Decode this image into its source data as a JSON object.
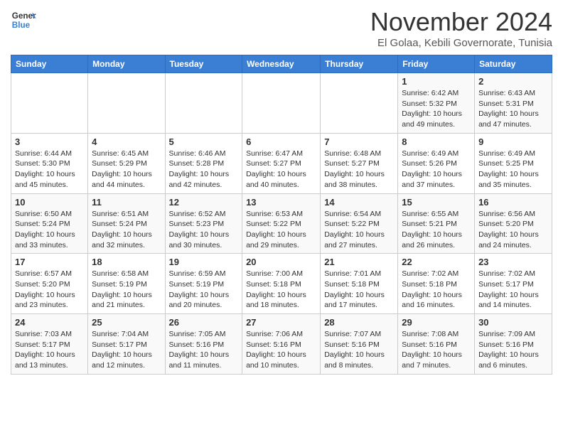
{
  "logo": {
    "line1": "General",
    "line2": "Blue"
  },
  "title": "November 2024",
  "subtitle": "El Golaa, Kebili Governorate, Tunisia",
  "weekdays": [
    "Sunday",
    "Monday",
    "Tuesday",
    "Wednesday",
    "Thursday",
    "Friday",
    "Saturday"
  ],
  "weeks": [
    [
      {
        "day": "",
        "info": ""
      },
      {
        "day": "",
        "info": ""
      },
      {
        "day": "",
        "info": ""
      },
      {
        "day": "",
        "info": ""
      },
      {
        "day": "",
        "info": ""
      },
      {
        "day": "1",
        "info": "Sunrise: 6:42 AM\nSunset: 5:32 PM\nDaylight: 10 hours\nand 49 minutes."
      },
      {
        "day": "2",
        "info": "Sunrise: 6:43 AM\nSunset: 5:31 PM\nDaylight: 10 hours\nand 47 minutes."
      }
    ],
    [
      {
        "day": "3",
        "info": "Sunrise: 6:44 AM\nSunset: 5:30 PM\nDaylight: 10 hours\nand 45 minutes."
      },
      {
        "day": "4",
        "info": "Sunrise: 6:45 AM\nSunset: 5:29 PM\nDaylight: 10 hours\nand 44 minutes."
      },
      {
        "day": "5",
        "info": "Sunrise: 6:46 AM\nSunset: 5:28 PM\nDaylight: 10 hours\nand 42 minutes."
      },
      {
        "day": "6",
        "info": "Sunrise: 6:47 AM\nSunset: 5:27 PM\nDaylight: 10 hours\nand 40 minutes."
      },
      {
        "day": "7",
        "info": "Sunrise: 6:48 AM\nSunset: 5:27 PM\nDaylight: 10 hours\nand 38 minutes."
      },
      {
        "day": "8",
        "info": "Sunrise: 6:49 AM\nSunset: 5:26 PM\nDaylight: 10 hours\nand 37 minutes."
      },
      {
        "day": "9",
        "info": "Sunrise: 6:49 AM\nSunset: 5:25 PM\nDaylight: 10 hours\nand 35 minutes."
      }
    ],
    [
      {
        "day": "10",
        "info": "Sunrise: 6:50 AM\nSunset: 5:24 PM\nDaylight: 10 hours\nand 33 minutes."
      },
      {
        "day": "11",
        "info": "Sunrise: 6:51 AM\nSunset: 5:24 PM\nDaylight: 10 hours\nand 32 minutes."
      },
      {
        "day": "12",
        "info": "Sunrise: 6:52 AM\nSunset: 5:23 PM\nDaylight: 10 hours\nand 30 minutes."
      },
      {
        "day": "13",
        "info": "Sunrise: 6:53 AM\nSunset: 5:22 PM\nDaylight: 10 hours\nand 29 minutes."
      },
      {
        "day": "14",
        "info": "Sunrise: 6:54 AM\nSunset: 5:22 PM\nDaylight: 10 hours\nand 27 minutes."
      },
      {
        "day": "15",
        "info": "Sunrise: 6:55 AM\nSunset: 5:21 PM\nDaylight: 10 hours\nand 26 minutes."
      },
      {
        "day": "16",
        "info": "Sunrise: 6:56 AM\nSunset: 5:20 PM\nDaylight: 10 hours\nand 24 minutes."
      }
    ],
    [
      {
        "day": "17",
        "info": "Sunrise: 6:57 AM\nSunset: 5:20 PM\nDaylight: 10 hours\nand 23 minutes."
      },
      {
        "day": "18",
        "info": "Sunrise: 6:58 AM\nSunset: 5:19 PM\nDaylight: 10 hours\nand 21 minutes."
      },
      {
        "day": "19",
        "info": "Sunrise: 6:59 AM\nSunset: 5:19 PM\nDaylight: 10 hours\nand 20 minutes."
      },
      {
        "day": "20",
        "info": "Sunrise: 7:00 AM\nSunset: 5:18 PM\nDaylight: 10 hours\nand 18 minutes."
      },
      {
        "day": "21",
        "info": "Sunrise: 7:01 AM\nSunset: 5:18 PM\nDaylight: 10 hours\nand 17 minutes."
      },
      {
        "day": "22",
        "info": "Sunrise: 7:02 AM\nSunset: 5:18 PM\nDaylight: 10 hours\nand 16 minutes."
      },
      {
        "day": "23",
        "info": "Sunrise: 7:02 AM\nSunset: 5:17 PM\nDaylight: 10 hours\nand 14 minutes."
      }
    ],
    [
      {
        "day": "24",
        "info": "Sunrise: 7:03 AM\nSunset: 5:17 PM\nDaylight: 10 hours\nand 13 minutes."
      },
      {
        "day": "25",
        "info": "Sunrise: 7:04 AM\nSunset: 5:17 PM\nDaylight: 10 hours\nand 12 minutes."
      },
      {
        "day": "26",
        "info": "Sunrise: 7:05 AM\nSunset: 5:16 PM\nDaylight: 10 hours\nand 11 minutes."
      },
      {
        "day": "27",
        "info": "Sunrise: 7:06 AM\nSunset: 5:16 PM\nDaylight: 10 hours\nand 10 minutes."
      },
      {
        "day": "28",
        "info": "Sunrise: 7:07 AM\nSunset: 5:16 PM\nDaylight: 10 hours\nand 8 minutes."
      },
      {
        "day": "29",
        "info": "Sunrise: 7:08 AM\nSunset: 5:16 PM\nDaylight: 10 hours\nand 7 minutes."
      },
      {
        "day": "30",
        "info": "Sunrise: 7:09 AM\nSunset: 5:16 PM\nDaylight: 10 hours\nand 6 minutes."
      }
    ]
  ]
}
